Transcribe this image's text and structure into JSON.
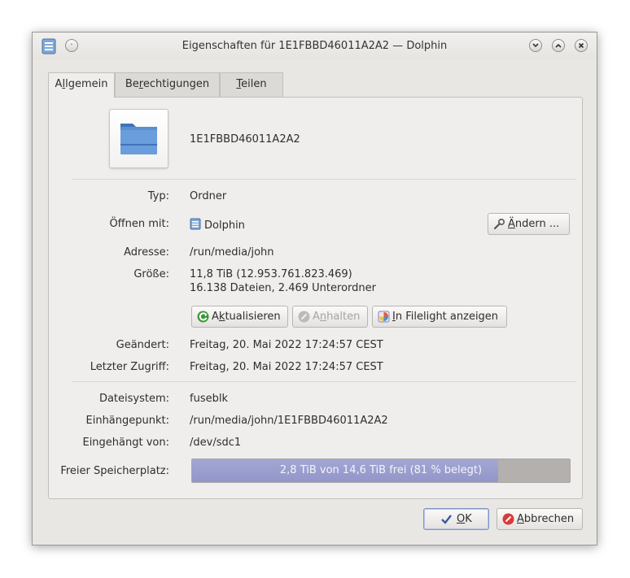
{
  "window": {
    "title": "Eigenschaften für 1E1FBBD46011A2A2 — Dolphin"
  },
  "tabs": [
    {
      "pre": "A",
      "key": "l",
      "post": "lgemein",
      "active": true
    },
    {
      "pre": "Be",
      "key": "r",
      "post": "echtigungen",
      "active": false
    },
    {
      "pre": "",
      "key": "T",
      "post": "eilen",
      "active": false
    }
  ],
  "header": {
    "name": "1E1FBBD46011A2A2",
    "icon": "folder-icon"
  },
  "props": {
    "type_label": "Typ:",
    "type_value": "Ordner",
    "open_label": "Öffnen mit:",
    "open_value": "Dolphin",
    "change_button": {
      "key": "Ä",
      "rest": "ndern ..."
    },
    "address_label": "Adresse:",
    "address_value": "/run/media/john",
    "size_label": "Größe:",
    "size_value": "11,8 TiB (12.953.761.823.469)",
    "size_detail": "16.138 Dateien, 2.469 Unterordner",
    "modified_label": "Geändert:",
    "modified_value": "Freitag, 20. Mai 2022 17:24:57 CEST",
    "accessed_label": "Letzter Zugriff:",
    "accessed_value": "Freitag, 20. Mai 2022 17:24:57 CEST",
    "fs_label": "Dateisystem:",
    "fs_value": "fuseblk",
    "mount_label": "Einhängepunkt:",
    "mount_value": "/run/media/john/1E1FBBD46011A2A2",
    "mounted_from_label": "Eingehängt von:",
    "mounted_from_value": "/dev/sdc1",
    "free_label": "Freier Speicherplatz:",
    "free_text": "2,8 TiB von 14,6 TiB frei (81 % belegt)",
    "used_fraction": 0.81
  },
  "size_buttons": {
    "refresh": {
      "pre": "A",
      "key": "k",
      "post": "tualisieren"
    },
    "stop": {
      "pre": "A",
      "key": "n",
      "post": "halten"
    },
    "filelight": {
      "pre": "",
      "key": "I",
      "post": "n Filelight anzeigen"
    }
  },
  "footer": {
    "ok": {
      "key": "O",
      "rest": "K"
    },
    "cancel": {
      "key": "A",
      "rest": "bbrechen"
    }
  },
  "colors": {
    "accent_fill": "#9a9ecf",
    "progress_bg": "#b4b0ad",
    "folder_blue": "#5b8fd0"
  }
}
